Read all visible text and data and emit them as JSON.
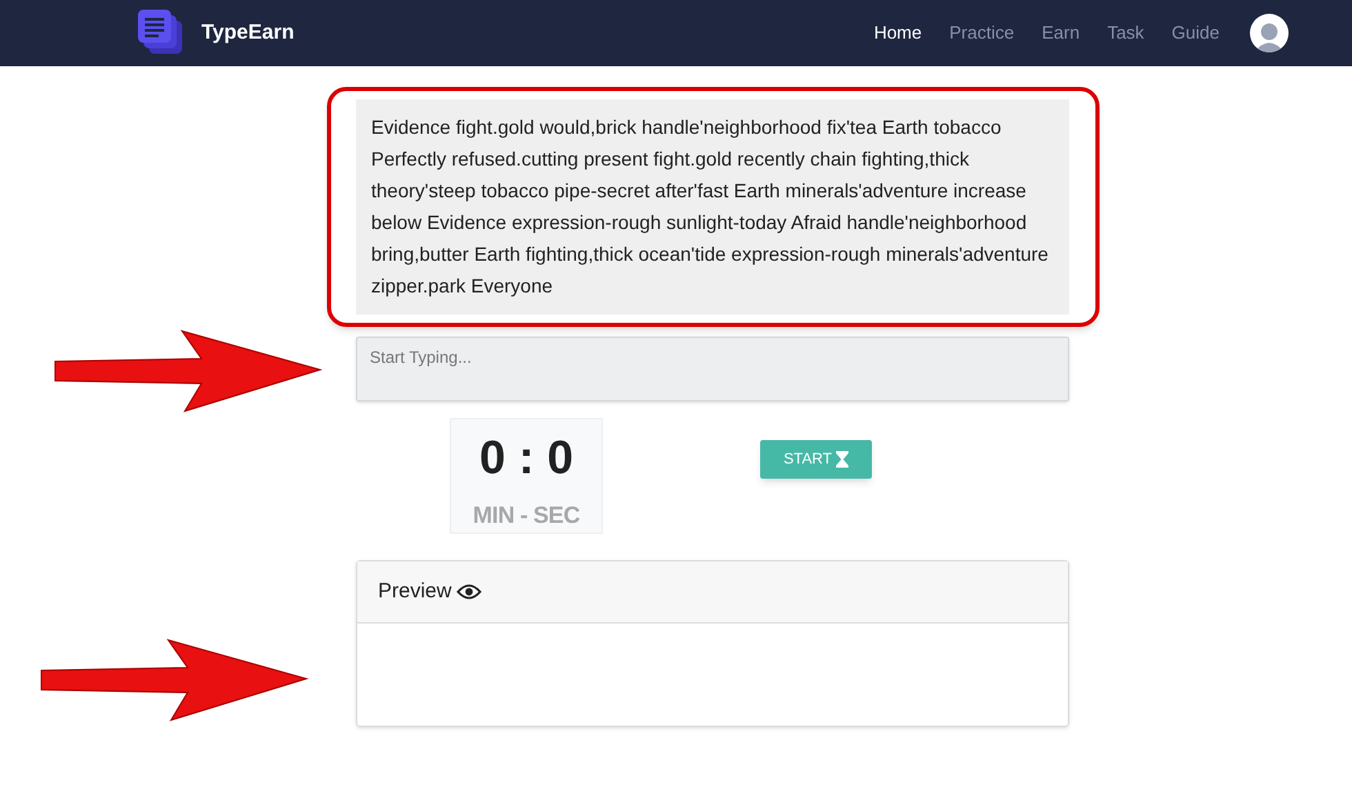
{
  "brand": {
    "name": "TypeEarn"
  },
  "nav": [
    {
      "label": "Home",
      "selected": true
    },
    {
      "label": "Practice",
      "selected": false
    },
    {
      "label": "Earn",
      "selected": false
    },
    {
      "label": "Task",
      "selected": false
    },
    {
      "label": "Guide",
      "selected": false
    }
  ],
  "passage": "Evidence fight.gold would,brick handle'neighborhood fix'tea Earth tobacco Perfectly refused.cutting present fight.gold recently chain fighting,thick theory'steep tobacco pipe-secret after'fast Earth minerals'adventure increase below Evidence expression-rough sunlight-today Afraid handle'neighborhood bring,butter Earth fighting,thick ocean'tide expression-rough minerals'adventure zipper.park Everyone",
  "typing_field": {
    "placeholder": "Start Typing..."
  },
  "timer": {
    "value": "0 : 0",
    "unit": "MIN - SEC"
  },
  "start_button": {
    "label": "START"
  },
  "preview": {
    "title": "Preview"
  }
}
